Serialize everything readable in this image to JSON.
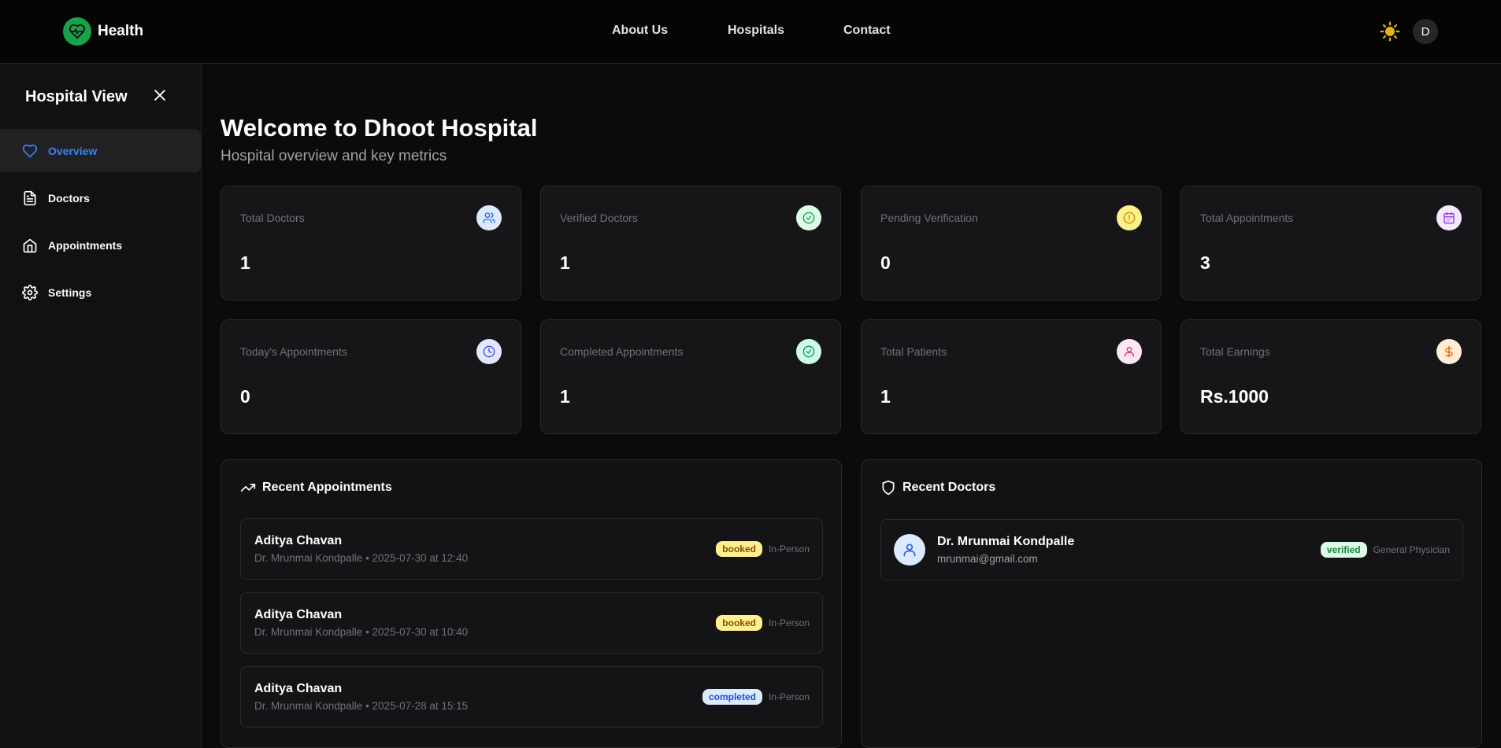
{
  "header": {
    "brand": "Health",
    "nav": [
      "About Us",
      "Hospitals",
      "Contact"
    ],
    "avatar_initial": "D",
    "theme_icon": "sun-icon"
  },
  "sidebar": {
    "title": "Hospital View",
    "items": [
      {
        "label": "Overview",
        "icon": "heart-icon",
        "active": true
      },
      {
        "label": "Doctors",
        "icon": "document-icon",
        "active": false
      },
      {
        "label": "Appointments",
        "icon": "home-icon",
        "active": false
      },
      {
        "label": "Settings",
        "icon": "gear-icon",
        "active": false
      }
    ]
  },
  "main": {
    "title": "Welcome to Dhoot Hospital",
    "subtitle": "Hospital overview and key metrics",
    "stats": [
      {
        "label": "Total Doctors",
        "value": "1",
        "icon": "users-icon",
        "color": "#2563eb",
        "bg": "#dbeafe"
      },
      {
        "label": "Verified Doctors",
        "value": "1",
        "icon": "check-circle-icon",
        "color": "#16a34a",
        "bg": "#dcfce7"
      },
      {
        "label": "Pending Verification",
        "value": "0",
        "icon": "alert-circle-icon",
        "color": "#ca8a04",
        "bg": "#fef08a"
      },
      {
        "label": "Total Appointments",
        "value": "3",
        "icon": "calendar-icon",
        "color": "#9333ea",
        "bg": "#f3e8ff"
      },
      {
        "label": "Today's Appointments",
        "value": "0",
        "icon": "clock-icon",
        "color": "#4f46e5",
        "bg": "#e0e7ff"
      },
      {
        "label": "Completed Appointments",
        "value": "1",
        "icon": "check-circle-icon",
        "color": "#059669",
        "bg": "#d1fae5"
      },
      {
        "label": "Total Patients",
        "value": "1",
        "icon": "user-icon",
        "color": "#db2777",
        "bg": "#fce7f3"
      },
      {
        "label": "Total Earnings",
        "value": "Rs.1000",
        "icon": "dollar-icon",
        "color": "#ea580c",
        "bg": "#ffedd5"
      }
    ],
    "recent_appointments": {
      "title": "Recent Appointments",
      "items": [
        {
          "patient": "Aditya Chavan",
          "detail": "Dr. Mrunmai Kondpalle • 2025-07-30 at 12:40",
          "status": "booked",
          "mode": "In-Person"
        },
        {
          "patient": "Aditya Chavan",
          "detail": "Dr. Mrunmai Kondpalle • 2025-07-30 at 10:40",
          "status": "booked",
          "mode": "In-Person"
        },
        {
          "patient": "Aditya Chavan",
          "detail": "Dr. Mrunmai Kondpalle • 2025-07-28 at 15:15",
          "status": "completed",
          "mode": "In-Person"
        }
      ]
    },
    "recent_doctors": {
      "title": "Recent Doctors",
      "items": [
        {
          "name": "Dr. Mrunmai Kondpalle",
          "email": "mrunmai@gmail.com",
          "status": "verified",
          "specialty": "General Physician"
        }
      ]
    }
  }
}
